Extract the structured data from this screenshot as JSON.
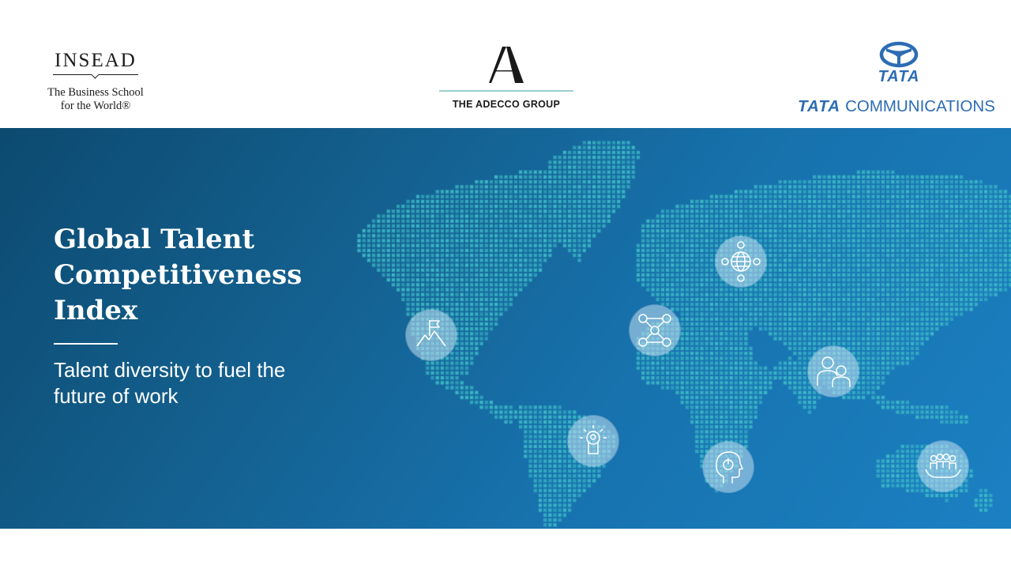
{
  "logos": {
    "insead": {
      "wordmark": "INSEAD",
      "tagline_line1": "The Business School",
      "tagline_line2": "for the World®"
    },
    "adecco": {
      "mark": "A",
      "name": "THE ADECCO GROUP"
    },
    "tata": {
      "mark": "TATA",
      "brand": "TATA",
      "division": "COMMUNICATIONS"
    }
  },
  "banner": {
    "title_line1": "Global Talent",
    "title_line2": "Competitiveness",
    "title_line3": "Index",
    "subtitle_line1": "Talent diversity to fuel the",
    "subtitle_line2": "future of work"
  },
  "icons": [
    "mountain-flag-icon",
    "people-network-icon",
    "globe-people-icon",
    "idea-person-icon",
    "head-power-icon",
    "two-people-icon",
    "team-hands-icon"
  ],
  "colors": {
    "banner_dark": "#0c4a70",
    "banner_light": "#1b80c2",
    "map_dots": "#37b1c4",
    "tata_blue": "#2d6cb4",
    "adecco_rule": "#9ccfcf"
  }
}
